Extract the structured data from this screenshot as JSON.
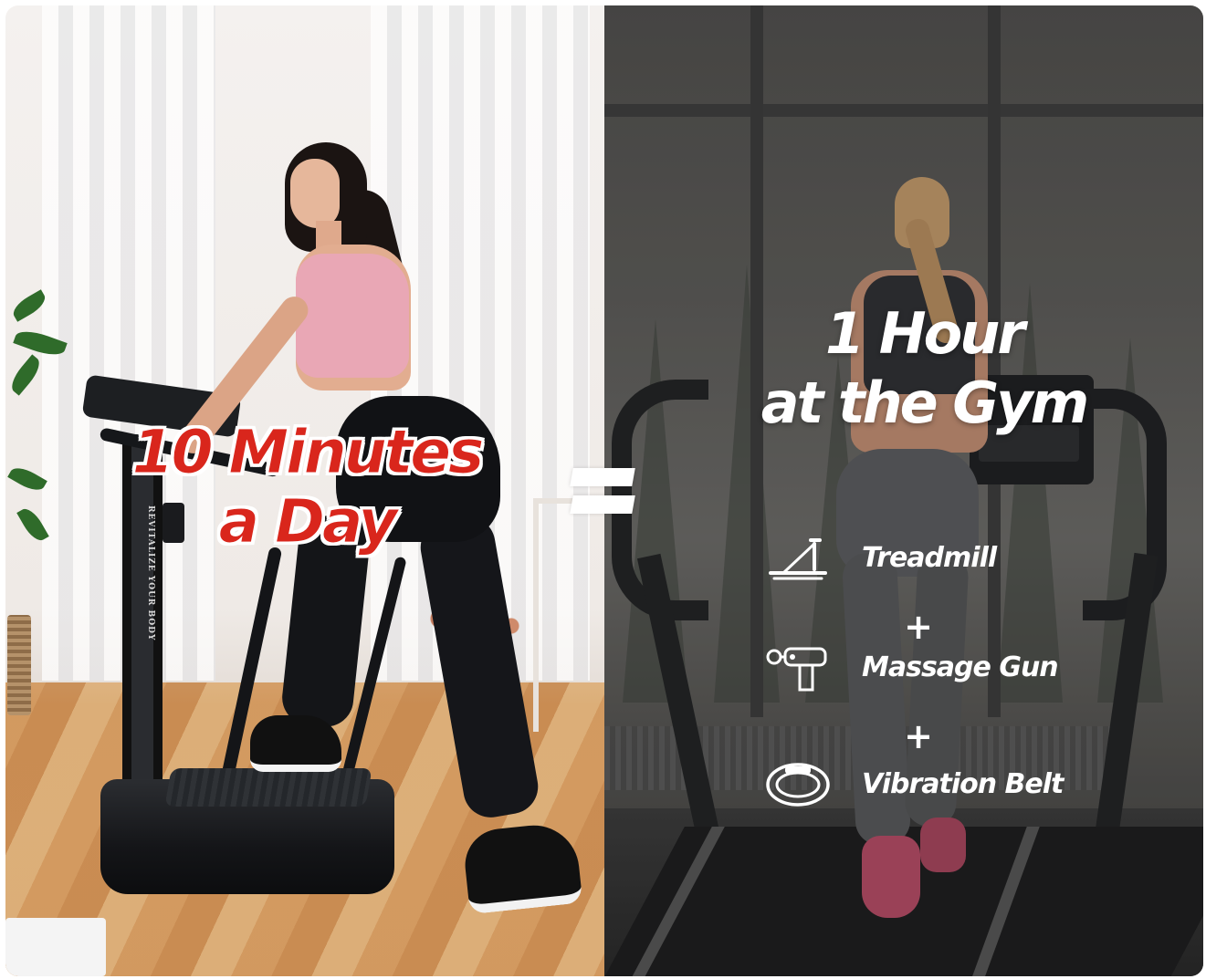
{
  "left_panel": {
    "headline_line1": "10 Minutes",
    "headline_line2": "a Day",
    "machine_column_text": "REVITALIZE YOUR BODY"
  },
  "equals_symbol": "=",
  "right_panel": {
    "headline_line1": "1 Hour",
    "headline_line2": "at the Gym",
    "features": [
      {
        "label": "Treadmill",
        "icon": "treadmill-icon"
      },
      {
        "label": "Massage Gun",
        "icon": "massage-gun-icon"
      },
      {
        "label": "Vibration Belt",
        "icon": "vibration-belt-icon"
      }
    ],
    "plus_symbol": "+"
  },
  "colors": {
    "headline_red": "#d9261c",
    "outline_white": "#ffffff",
    "right_text": "#ffffff"
  }
}
